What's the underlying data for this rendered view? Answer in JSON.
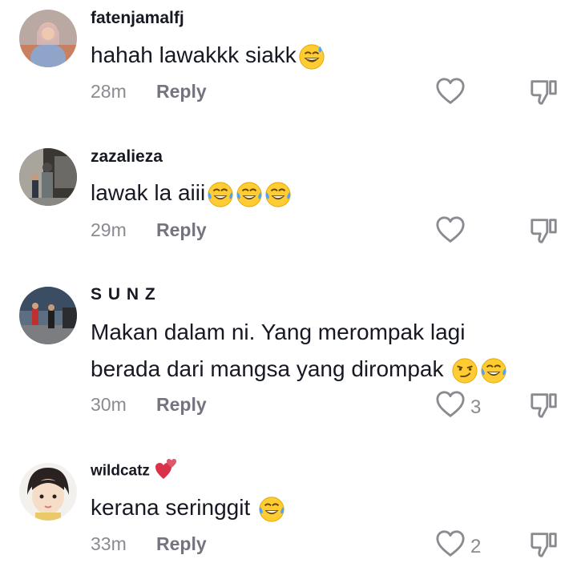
{
  "reply_label": "Reply",
  "comments": [
    {
      "username": "fatenjamalfj",
      "text": "hahah lawakkk siakk",
      "emojis": [
        "grinning-sweat-emoji"
      ],
      "time": "28m",
      "likes": ""
    },
    {
      "username": "zazalieza",
      "text": "lawak la aiii",
      "emojis": [
        "tears-of-joy-emoji",
        "tears-of-joy-emoji",
        "tears-of-joy-emoji"
      ],
      "time": "29m",
      "likes": ""
    },
    {
      "username": "S U N Z",
      "text_line1": "Makan dalam ni. Yang merompak lagi",
      "text_line2": "berada dari mangsa yang dirompak ",
      "emojis": [
        "smirking-emoji",
        "tears-of-joy-emoji"
      ],
      "time": "30m",
      "likes": "3"
    },
    {
      "username": "wildcatz",
      "username_badge": "two-hearts-emoji",
      "text": "kerana seringgit ",
      "emojis": [
        "tears-of-joy-emoji"
      ],
      "time": "33m",
      "likes": "2"
    }
  ],
  "colors": {
    "text": "#161823",
    "meta": "#8a8b91",
    "emoji_face": "#ffcc33",
    "tear": "#4aa3ff"
  }
}
